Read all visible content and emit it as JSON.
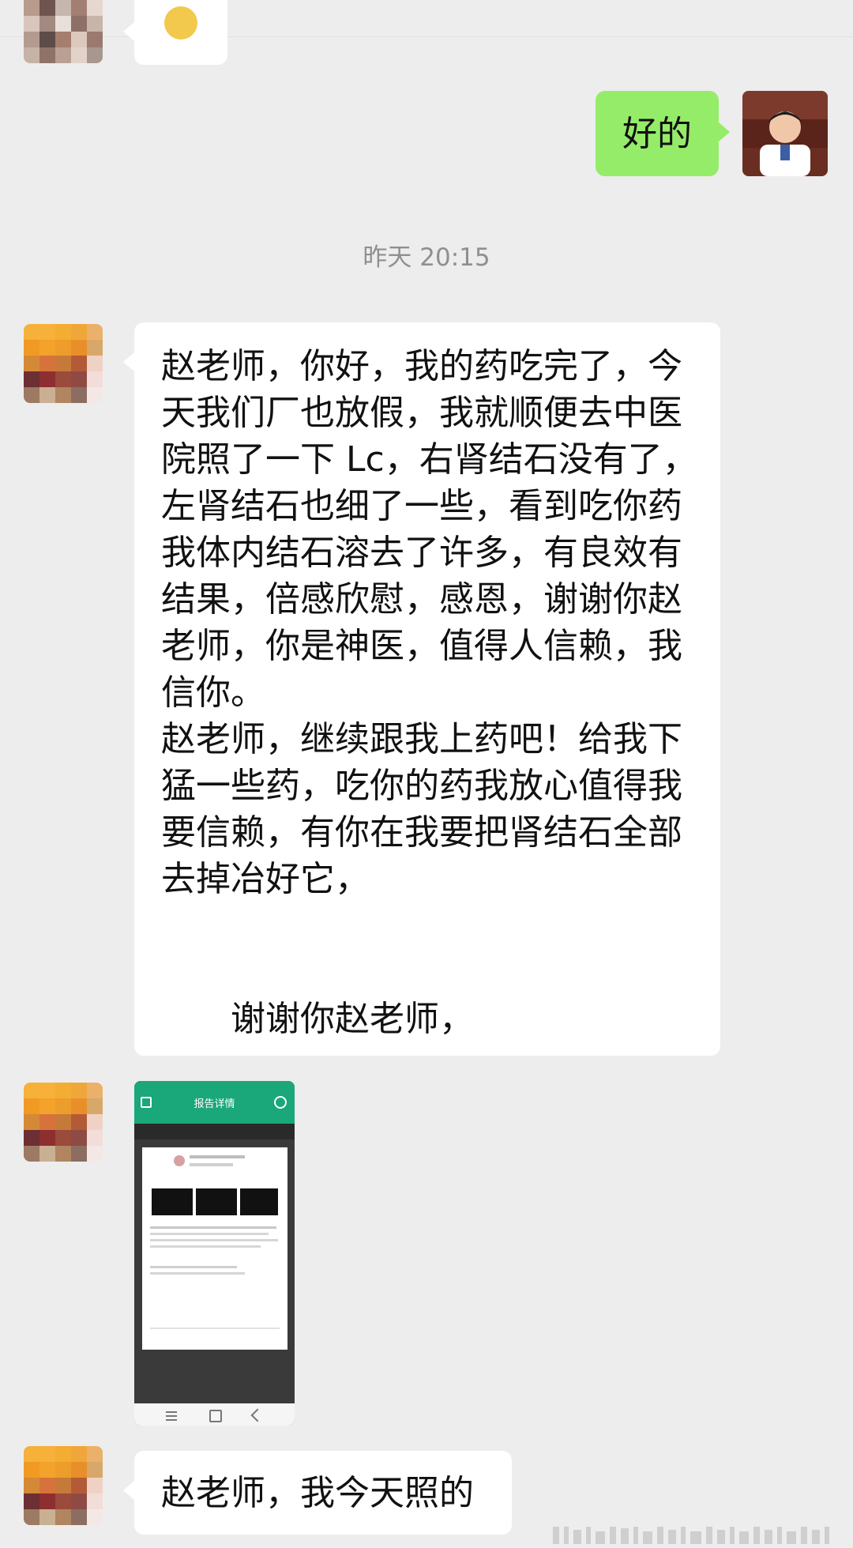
{
  "chat": {
    "timestamp": "昨天 20:15",
    "messages": [
      {
        "side": "right",
        "text": "好的"
      },
      {
        "side": "left",
        "lines": [
          "赵老师，你好，我的药吃完了，今",
          "天我们厂也放假，我就顺便去中医",
          "院照了一下 Lc，右肾结石没有了，",
          "左肾结石也细了一些，看到吃你药",
          "我体内结石溶去了许多，有良效有",
          "结果，倍感欣慰，感恩，谢谢你赵",
          "老师，你是神医，值得人信赖，我",
          "信你。",
          "赵老师，继续跟我上药吧！给我下",
          "猛一些药，吃你的药我放心值得我",
          "要信赖，有你在我要把肾结石全部",
          "去掉冶好它，",
          "",
          "",
          "　　谢谢你赵老师，"
        ]
      },
      {
        "side": "left",
        "type": "image",
        "title": "报告详情"
      },
      {
        "side": "left",
        "text": "赵老师，我今天照的"
      }
    ]
  },
  "colors": {
    "background": "#ededed",
    "bubble_self": "#95ec69",
    "bubble_other": "#ffffff",
    "timestamp": "#8f8f8f",
    "report_header": "#1aa77a"
  },
  "icons": {
    "doctor_avatar": "doctor-avatar-icon",
    "contact_avatar": "pixelated-avatar-icon"
  }
}
